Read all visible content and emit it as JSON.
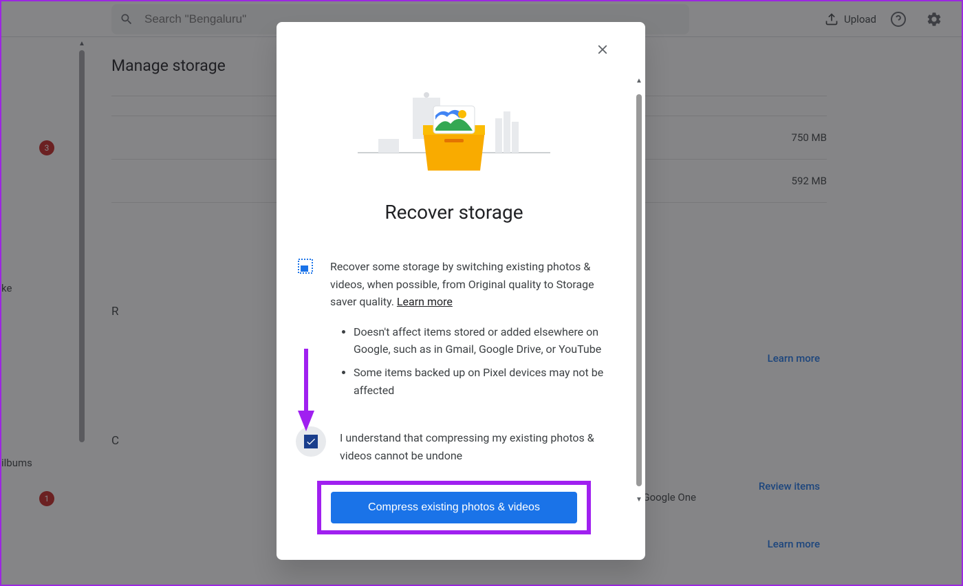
{
  "header": {
    "search_placeholder": "Search \"Bengaluru\"",
    "upload_label": "Upload"
  },
  "sidebar": {
    "item_ke": "ke",
    "item_albums": "ilbums",
    "badge1": "3",
    "badge2": "1"
  },
  "page": {
    "title": "Manage storage",
    "storage_value_1": "750 MB",
    "storage_value_2": "592 MB",
    "section_r": "R",
    "section_c": "C",
    "link_learn_more": "Learn more",
    "link_review_items": "Review items",
    "google_one": "Google One"
  },
  "modal": {
    "title": "Recover storage",
    "description": "Recover some storage by switching existing photos & videos, when possible, from Original quality to Storage saver quality. ",
    "learn_more": "Learn more",
    "bullets": [
      "Doesn't affect items stored or added elsewhere on Google, such as in Gmail, Google Drive, or YouTube",
      "Some items backed up on Pixel devices may not be affected"
    ],
    "consent": "I understand that compressing my existing photos & videos cannot be undone",
    "cta": "Compress existing photos & videos",
    "checkbox_checked": "true"
  }
}
